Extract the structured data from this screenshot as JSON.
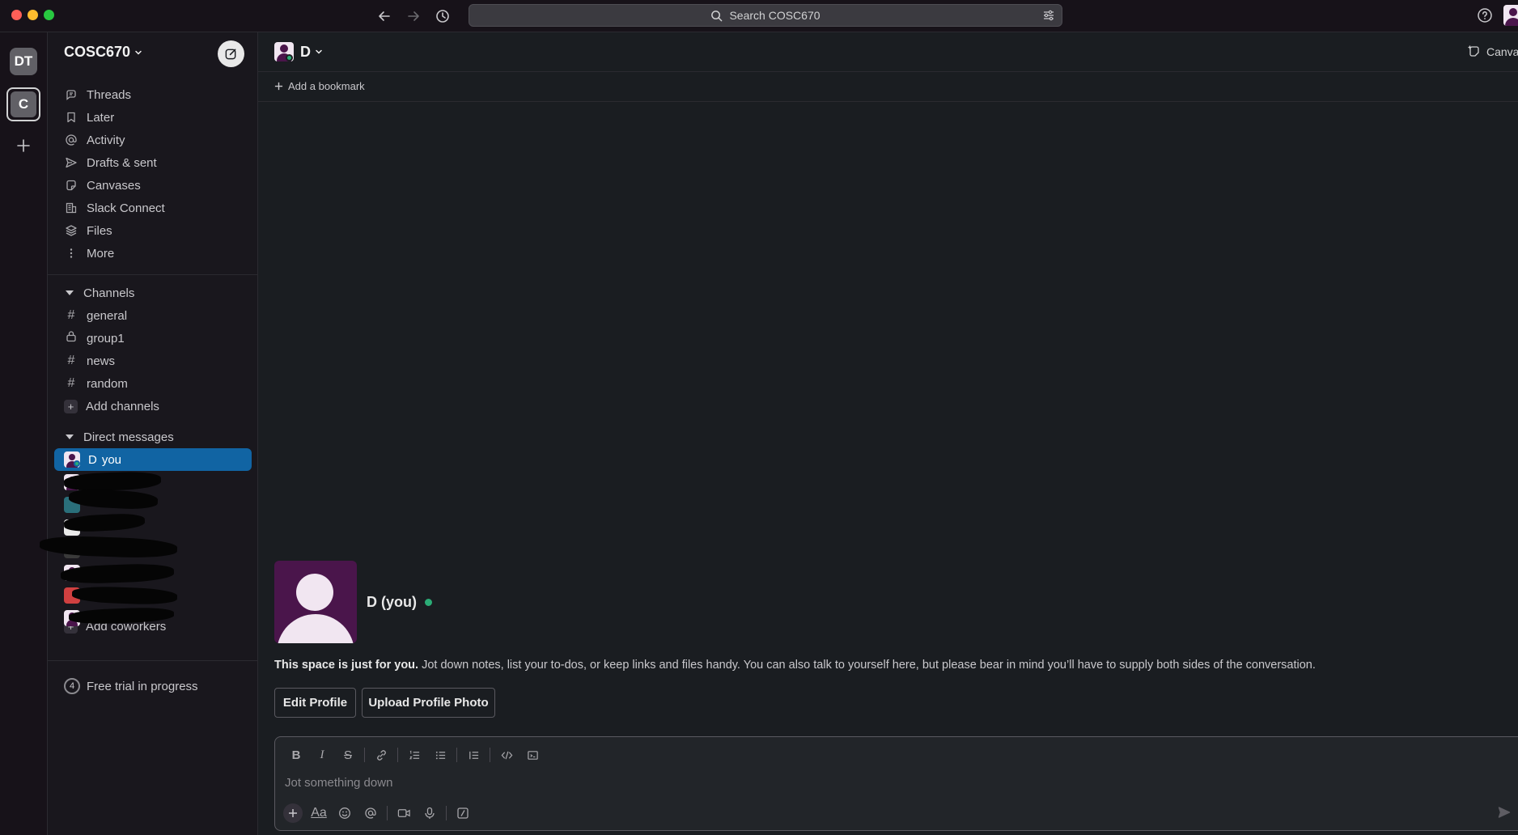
{
  "search": {
    "placeholder": "Search COSC670"
  },
  "workspaces": [
    {
      "initials": "DT"
    },
    {
      "initials": "C"
    }
  ],
  "sidebar": {
    "workspace_name": "COSC670",
    "nav": [
      {
        "label": "Threads",
        "icon": "threads-icon"
      },
      {
        "label": "Later",
        "icon": "bookmark-icon"
      },
      {
        "label": "Activity",
        "icon": "at-icon"
      },
      {
        "label": "Drafts & sent",
        "icon": "send-icon"
      },
      {
        "label": "Canvases",
        "icon": "canvas-icon"
      },
      {
        "label": "Slack Connect",
        "icon": "building-icon"
      },
      {
        "label": "Files",
        "icon": "layers-icon"
      },
      {
        "label": "More",
        "icon": "more-vertical-icon"
      }
    ],
    "channels_header": "Channels",
    "channels": [
      {
        "name": "general",
        "icon": "#"
      },
      {
        "name": "group1",
        "icon": "lock"
      },
      {
        "name": "news",
        "icon": "#"
      },
      {
        "name": "random",
        "icon": "#"
      }
    ],
    "add_channels": "Add channels",
    "dms_header": "Direct messages",
    "dm_self": {
      "name": "D",
      "suffix": "you"
    },
    "add_coworkers": "Add coworkers",
    "trial": {
      "count": "4",
      "label": "Free trial in progress"
    }
  },
  "header": {
    "title": "D",
    "canvas_label": "Canvas",
    "add_bookmark": "Add a bookmark"
  },
  "intro": {
    "name": "D (you)",
    "bold_text": "This space is just for you.",
    "text": " Jot down notes, list your to-dos, or keep links and files handy. You can also talk to yourself here, but please bear in mind you’ll have to supply both sides of the conversation.",
    "edit_profile": "Edit Profile",
    "upload_photo": "Upload Profile Photo"
  },
  "composer": {
    "placeholder": "Jot something down",
    "format_tools": [
      "bold",
      "italic",
      "strikethrough",
      "link",
      "ordered-list",
      "bullet-list",
      "blockquote",
      "code",
      "code-block"
    ],
    "aa_label": "Aa"
  },
  "colors": {
    "accent": "#1164a3",
    "online": "#2bac76",
    "avatar_bg": "#4a154b"
  }
}
